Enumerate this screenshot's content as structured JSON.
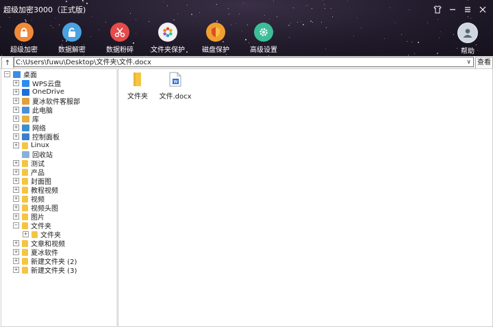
{
  "window": {
    "title": "超级加密3000（正式版)",
    "controls": [
      "skin",
      "minimize",
      "menu",
      "close"
    ]
  },
  "toolbar": {
    "items": [
      {
        "label": "超级加密",
        "icon": "lock-icon",
        "color": "#f08a3a"
      },
      {
        "label": "数据解密",
        "icon": "unlock-icon",
        "color": "#4aa3e0"
      },
      {
        "label": "数据粉碎",
        "icon": "scissors-icon",
        "color": "#e64a4a"
      },
      {
        "label": "文件夹保护",
        "icon": "color-wheel-icon",
        "color": "#f2f2f2"
      },
      {
        "label": "磁盘保护",
        "icon": "shield-icon",
        "color": "#f0a030"
      },
      {
        "label": "高级设置",
        "icon": "gear-icon",
        "color": "#3dbd9a"
      }
    ],
    "help_label": "帮助"
  },
  "address": {
    "up_label": "↑",
    "path": "C:\\Users\\fuwu\\Desktop\\文件夹\\文件.docx",
    "view_label": "查看"
  },
  "tree": [
    {
      "label": "桌面",
      "icon": "desktop-icon",
      "level": 0,
      "expander": "−"
    },
    {
      "label": "WPS云盘",
      "icon": "cloud-icon",
      "level": 1,
      "expander": "+"
    },
    {
      "label": "OneDrive",
      "icon": "onedrive-icon",
      "level": 1,
      "expander": "+"
    },
    {
      "label": "夏冰软件客服部",
      "icon": "user-icon",
      "level": 1,
      "expander": "+"
    },
    {
      "label": "此电脑",
      "icon": "computer-icon",
      "level": 1,
      "expander": "+"
    },
    {
      "label": "库",
      "icon": "library-icon",
      "level": 1,
      "expander": "+"
    },
    {
      "label": "网络",
      "icon": "network-icon",
      "level": 1,
      "expander": "+"
    },
    {
      "label": "控制面板",
      "icon": "control-panel-icon",
      "level": 1,
      "expander": "+"
    },
    {
      "label": "Linux",
      "icon": "folder-icon",
      "level": 1,
      "expander": "+"
    },
    {
      "label": "回收站",
      "icon": "recycle-bin-icon",
      "level": 1,
      "expander": ""
    },
    {
      "label": "测试",
      "icon": "folder-icon",
      "level": 1,
      "expander": "+"
    },
    {
      "label": "产品",
      "icon": "folder-icon",
      "level": 1,
      "expander": "+"
    },
    {
      "label": "封面图",
      "icon": "folder-icon",
      "level": 1,
      "expander": "+"
    },
    {
      "label": "教程视频",
      "icon": "folder-icon",
      "level": 1,
      "expander": "+"
    },
    {
      "label": "视频",
      "icon": "folder-icon",
      "level": 1,
      "expander": "+"
    },
    {
      "label": "视频头图",
      "icon": "folder-icon",
      "level": 1,
      "expander": "+"
    },
    {
      "label": "图片",
      "icon": "folder-icon",
      "level": 1,
      "expander": "+"
    },
    {
      "label": "文件夹",
      "icon": "folder-icon",
      "level": 1,
      "expander": "−"
    },
    {
      "label": "文件夹",
      "icon": "folder-icon",
      "level": 2,
      "expander": "+"
    },
    {
      "label": "文章和视频",
      "icon": "folder-icon",
      "level": 1,
      "expander": "+"
    },
    {
      "label": "夏冰软件",
      "icon": "folder-icon",
      "level": 1,
      "expander": "+"
    },
    {
      "label": "新建文件夹 (2)",
      "icon": "folder-icon",
      "level": 1,
      "expander": "+"
    },
    {
      "label": "新建文件夹 (3)",
      "icon": "folder-icon",
      "level": 1,
      "expander": "+"
    }
  ],
  "files": [
    {
      "label": "文件夹",
      "icon": "folder-icon"
    },
    {
      "label": "文件.docx",
      "icon": "word-doc-icon"
    }
  ]
}
